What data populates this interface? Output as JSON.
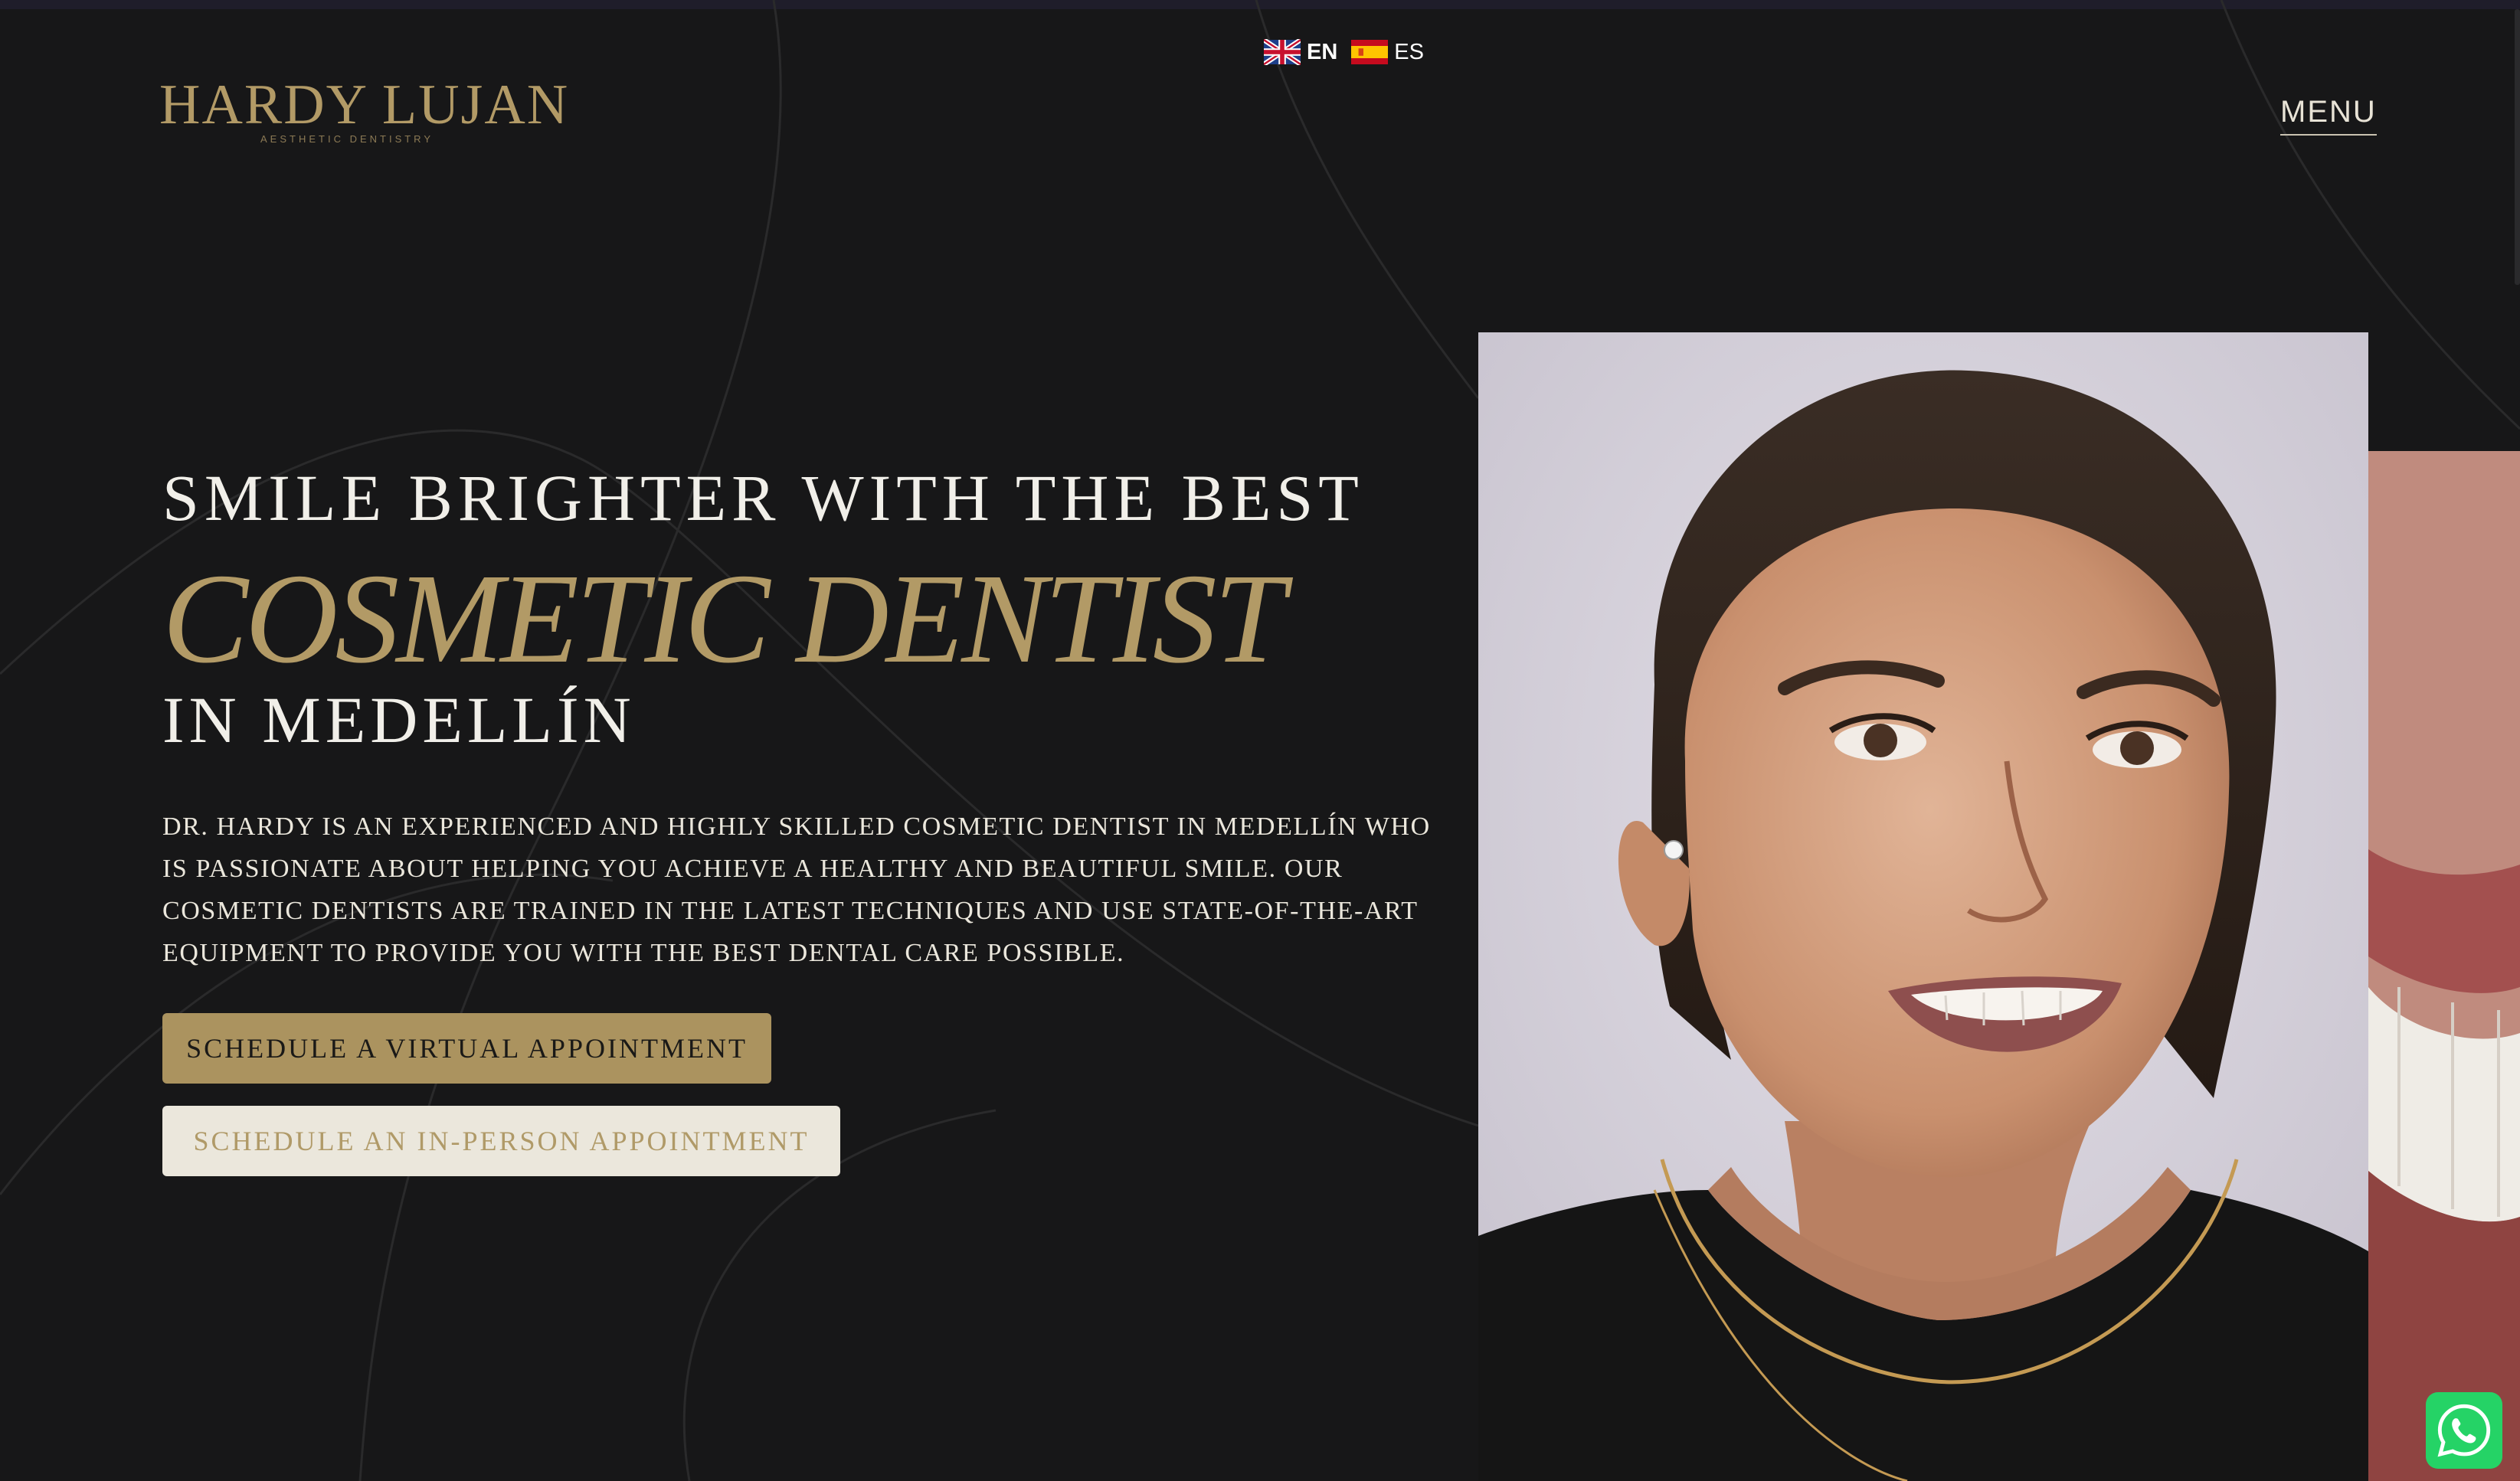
{
  "language": {
    "options": [
      {
        "code": "EN",
        "flag_icon": "uk-flag-icon",
        "active": true
      },
      {
        "code": "ES",
        "flag_icon": "spain-flag-icon",
        "active": false
      }
    ]
  },
  "logo": {
    "wordmark": "HARDY LUJAN",
    "tagline": "AESTHETIC DENTISTRY"
  },
  "nav": {
    "menu_label": "MENU"
  },
  "hero": {
    "line1": "SMILE BRIGHTER WITH THE BEST",
    "line2": "COSMETIC DENTIST",
    "line3": "IN MEDELLÍN",
    "description": "DR. HARDY IS AN EXPERIENCED AND HIGHLY SKILLED COSMETIC DENTIST IN MEDELLÍN WHO IS PASSIONATE ABOUT HELPING YOU ACHIEVE A HEALTHY AND BEAUTIFUL SMILE. OUR COSMETIC DENTISTS ARE TRAINED IN THE LATEST TECHNIQUES AND USE STATE-OF-THE-ART EQUIPMENT TO PROVIDE YOU WITH THE BEST DENTAL CARE POSSIBLE.",
    "buttons": {
      "virtual": "SCHEDULE A VIRTUAL APPOINTMENT",
      "in_person": "SCHEDULE AN IN-PERSON APPOINTMENT"
    }
  },
  "images": {
    "main": "smiling-woman-portrait",
    "side": "smile-close-up"
  },
  "floating": {
    "whatsapp_icon": "whatsapp-icon"
  },
  "colors": {
    "background": "#171718",
    "gold": "#b29a66",
    "cream": "#ebe7dc",
    "whatsapp": "#25d366"
  }
}
